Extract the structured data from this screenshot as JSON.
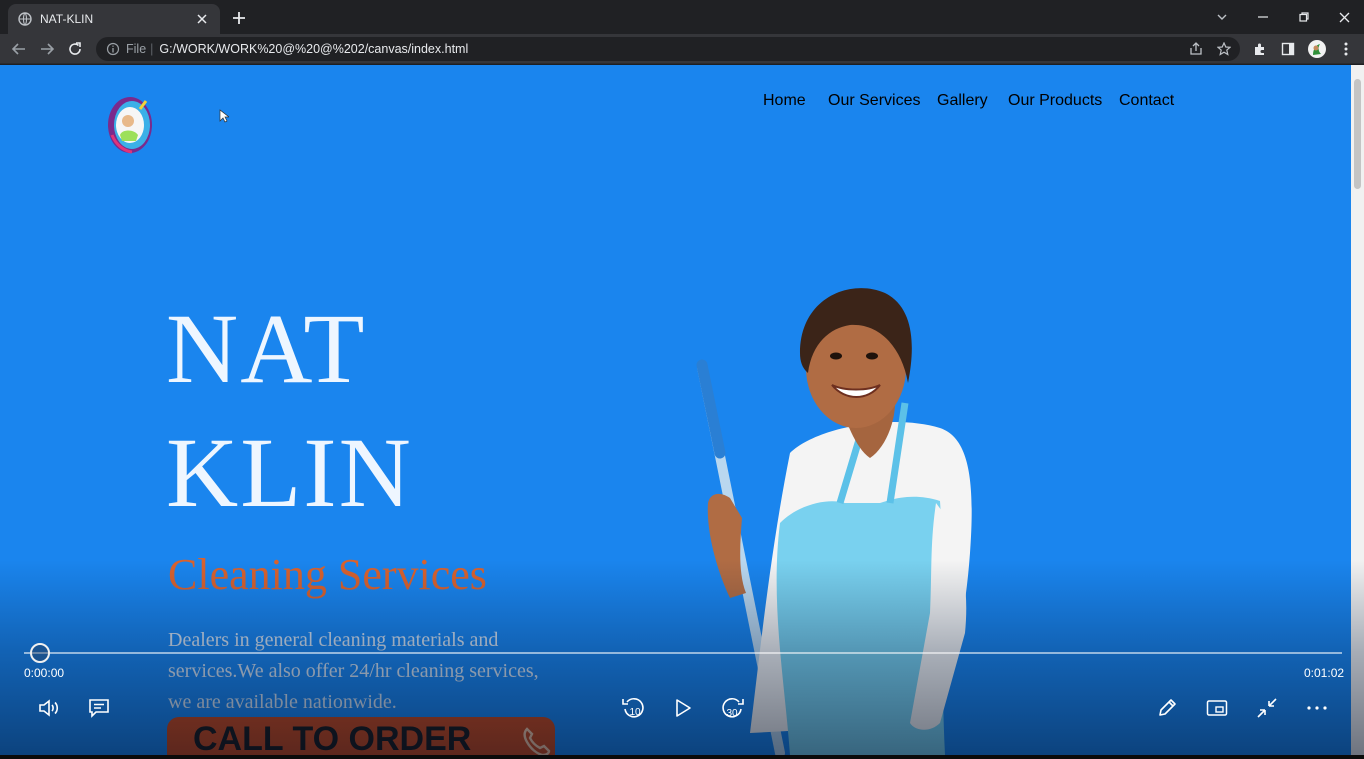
{
  "browser": {
    "tab_title": "NAT-KLIN",
    "url_scheme": "File",
    "url": "G:/WORK/WORK%20@%20@%202/canvas/index.html"
  },
  "site": {
    "nav": [
      "Home",
      "Our Services",
      "Gallery",
      "Our Products",
      "Contact"
    ],
    "hero_line1": "NAT",
    "hero_line2": "KLIN",
    "subtitle": "Cleaning Services",
    "description": "Dealers in general cleaning materials and services.We also offer 24/hr cleaning services, we are available nationwide.",
    "cta_label": "CALL TO ORDER",
    "colors": {
      "background": "#1a85ee",
      "subtitle": "#d9622e",
      "cta": "#c9491c"
    }
  },
  "player": {
    "current_time": "0:00:00",
    "total_time": "0:01:02",
    "progress": 0.0,
    "skip_back_seconds": "10",
    "skip_forward_seconds": "30",
    "icons": [
      "volume-icon",
      "captions-icon",
      "skip-back-10-icon",
      "play-icon",
      "skip-forward-30-icon",
      "pen-icon",
      "mini-view-icon",
      "exit-fullscreen-icon",
      "more-icon"
    ]
  }
}
